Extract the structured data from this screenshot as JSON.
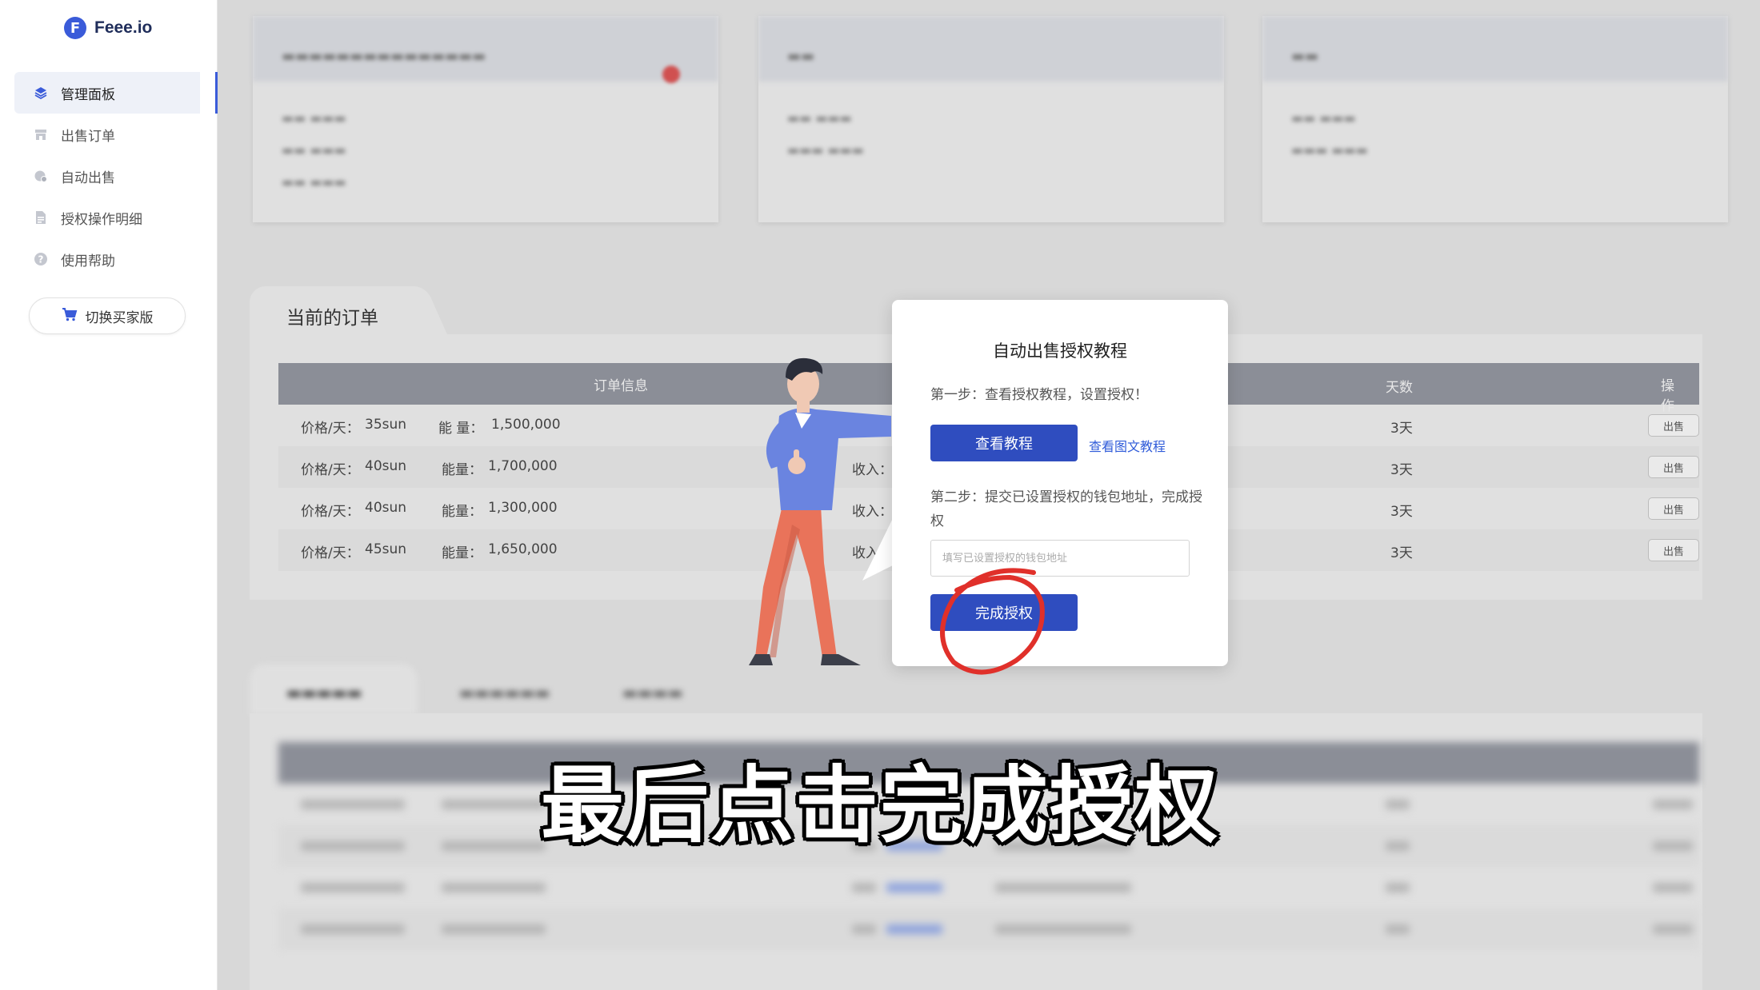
{
  "app": {
    "logo_text": "Feee.io",
    "logo_letter": "F"
  },
  "sidebar": {
    "items": [
      {
        "label": "管理面板",
        "icon": "layers-icon",
        "active": true
      },
      {
        "label": "出售订单",
        "icon": "store-icon",
        "active": false
      },
      {
        "label": "自动出售",
        "icon": "auto-sell-icon",
        "active": false
      },
      {
        "label": "授权操作明细",
        "icon": "document-icon",
        "active": false
      },
      {
        "label": "使用帮助",
        "icon": "help-icon",
        "active": false
      }
    ],
    "switch_label": "切换买家版"
  },
  "orders": {
    "tab_label": "当前的订单",
    "columns": {
      "info": "订单信息",
      "days": "天数",
      "action": "操作"
    },
    "rows": [
      {
        "price_label": "价格/天：",
        "price": "35sun",
        "energy_label": "能 量：",
        "energy": "1,500,000",
        "income_label": "",
        "days": "3天",
        "action": "出售"
      },
      {
        "price_label": "价格/天：",
        "price": "40sun",
        "energy_label": "能量：",
        "energy": "1,700,000",
        "income_label": "收入：",
        "days": "3天",
        "action": "出售"
      },
      {
        "price_label": "价格/天：",
        "price": "40sun",
        "energy_label": "能量：",
        "energy": "1,300,000",
        "income_label": "收入：",
        "days": "3天",
        "action": "出售"
      },
      {
        "price_label": "价格/天：",
        "price": "45sun",
        "energy_label": "能量：",
        "energy": "1,650,000",
        "income_label": "收入",
        "days": "3天",
        "action": "出售"
      }
    ]
  },
  "modal": {
    "title": "自动出售授权教程",
    "step1": "第一步：查看授权教程，设置授权！",
    "view_tutorial_button": "查看教程",
    "view_text_tutorial_link": "查看图文教程",
    "step2": "第二步：提交已设置授权的钱包地址，完成授权",
    "address_placeholder": "填写已设置授权的钱包地址",
    "complete_button": "完成授权"
  },
  "caption": "最后点击完成授权",
  "colors": {
    "accent": "#2f4dbf",
    "brand": "#3a5bd9",
    "annotation": "#e0302a"
  }
}
